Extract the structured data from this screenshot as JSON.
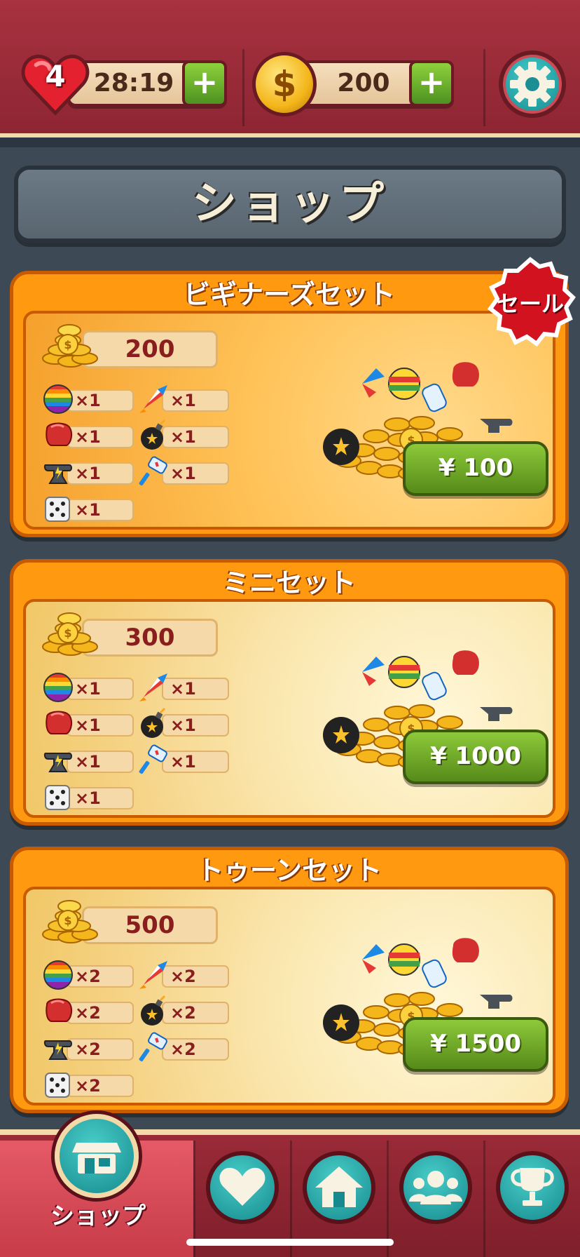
{
  "status": {
    "lives": "4",
    "timer": "28:19",
    "coins": "200"
  },
  "shop": {
    "title": "ショップ"
  },
  "offers": [
    {
      "title": "ビギナーズセット",
      "coins": "200",
      "items": [
        "×1",
        "×1",
        "×1",
        "×1",
        "×1",
        "×1",
        "×1"
      ],
      "price": "¥ 100",
      "badge": "セール"
    },
    {
      "title": "ミニセット",
      "coins": "300",
      "items": [
        "×1",
        "×1",
        "×1",
        "×1",
        "×1",
        "×1",
        "×1"
      ],
      "price": "¥ 1000"
    },
    {
      "title": "トゥーンセット",
      "coins": "500",
      "items": [
        "×2",
        "×2",
        "×2",
        "×2",
        "×2",
        "×2",
        "×2"
      ],
      "price": "¥ 1500"
    }
  ],
  "item_icons": [
    "rainbow-ball-icon",
    "rocket-icon",
    "boxing-glove-icon",
    "bomb-icon",
    "anvil-icon",
    "hammer-icon",
    "dice-icon"
  ],
  "nav": {
    "shop_label": "ショップ",
    "items": [
      "shop-icon",
      "heart-icon",
      "home-icon",
      "friends-icon",
      "trophy-icon"
    ]
  },
  "colors": {
    "topbar": "#a8323f",
    "card": "#ff9a10",
    "price_button": "#6fae28",
    "nav_button": "#168a8e"
  }
}
